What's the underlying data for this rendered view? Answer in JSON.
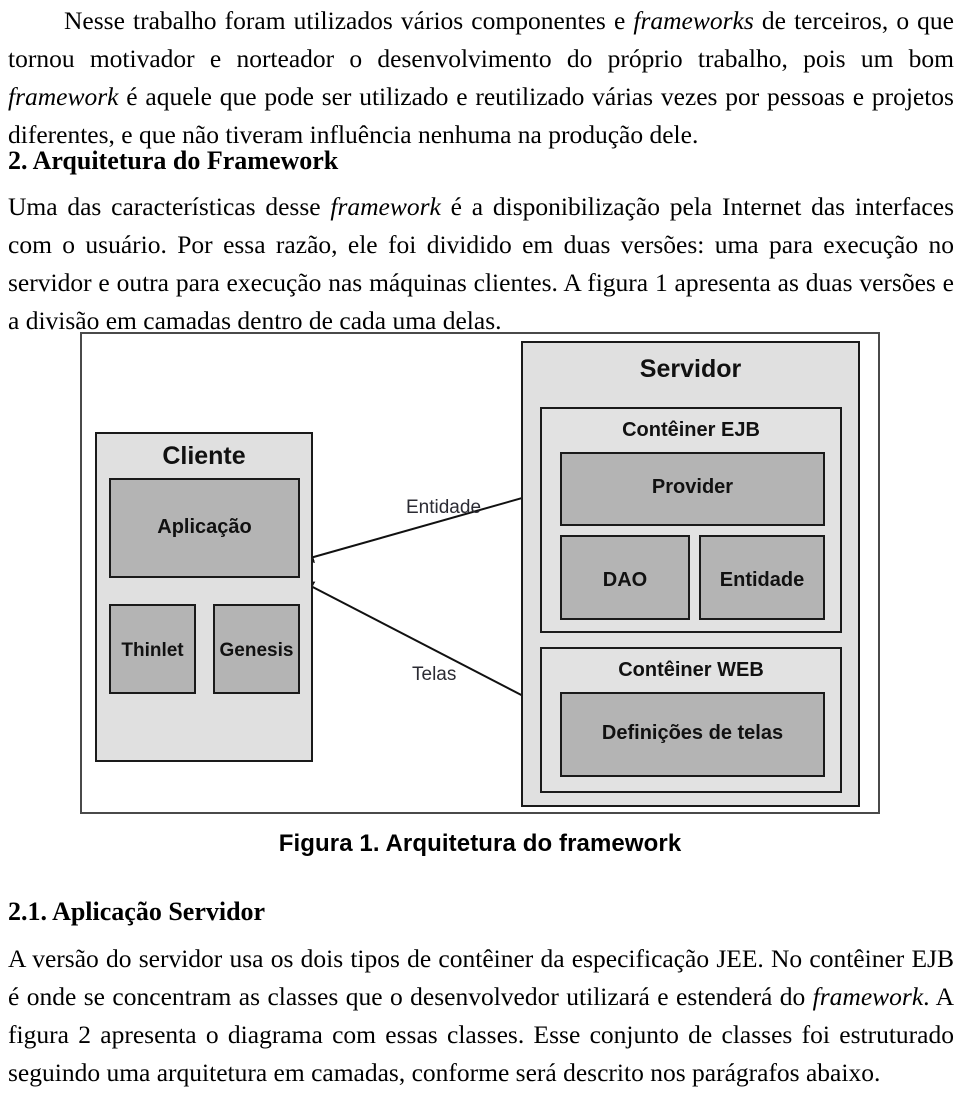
{
  "document": {
    "paragraphs": {
      "intro": "Nesse trabalho foram utilizados vários componentes e frameworks de terceiros, o que tornou motivador e norteador o desenvolvimento do próprio trabalho, pois um bom framework é aquele que pode ser utilizado e reutilizado várias vezes por pessoas e projetos diferentes, e que não tiveram influência nenhuma na produção dele.",
      "architecture": "Uma das características desse framework é a disponibilização pela Internet das interfaces com o usuário. Por essa razão, ele foi dividido em duas versões: uma para execução no servidor e outra para execução nas máquinas clientes. A figura 1 apresenta as duas versões e a divisão em camadas dentro de cada uma delas.",
      "server_app": "A versão do servidor usa os dois tipos de contêiner da especificação JEE. No contêiner EJB é onde se concentram as classes que o desenvolvedor utilizará e estenderá do framework. A figura 2 apresenta o diagrama com essas classes. Esse conjunto de classes foi estruturado seguindo uma arquitetura em camadas, conforme será descrito nos parágrafos abaixo."
    },
    "headings": {
      "section_2": "2. Arquitetura do Framework",
      "section_21": "2.1. Aplicação Servidor"
    },
    "figure": {
      "caption": "Figura 1. Arquitetura do framework",
      "boxes": {
        "cliente": "Cliente",
        "aplicacao": "Aplicação",
        "thinlet": "Thinlet",
        "genesis": "Genesis",
        "servidor": "Servidor",
        "conteiner_ejb": "Contêiner EJB",
        "provider": "Provider",
        "dao": "DAO",
        "entidade": "Entidade",
        "conteiner_web": "Contêiner WEB",
        "definicoes_de_telas": "Definições de telas"
      },
      "edge_labels": {
        "entidade": "Entidade",
        "telas": "Telas"
      },
      "colors": {
        "container_fill": "#e0e0e0",
        "subcontainer_fill": "#e2e2e2",
        "leaf_fill": "#b4b4b4",
        "border": "#1a1a1a",
        "frame_border": "#4a4a4a",
        "page_background": "#ffffff"
      }
    }
  }
}
